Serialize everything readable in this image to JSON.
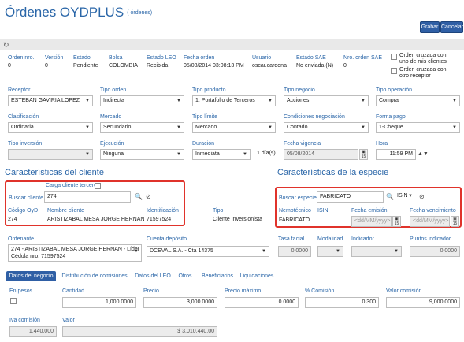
{
  "header": {
    "title": "Órdenes OYDPLUS",
    "subtitle": "( órdenes)"
  },
  "actions": {
    "save": "Grabar",
    "cancel": "Cancelar"
  },
  "summary": {
    "orden_nro": {
      "label": "Orden nro.",
      "value": "0"
    },
    "version": {
      "label": "Versión",
      "value": "0"
    },
    "estado": {
      "label": "Estado",
      "value": "Pendiente"
    },
    "bolsa": {
      "label": "Bolsa",
      "value": "COLOMBIA"
    },
    "estado_leo": {
      "label": "Estado LEO",
      "value": "Recibida"
    },
    "fecha_orden": {
      "label": "Fecha orden",
      "value": "05/08/2014 03:08:13 PM"
    },
    "usuario": {
      "label": "Usuario",
      "value": "oscar.cardona"
    },
    "estado_sae": {
      "label": "Estado SAE",
      "value": "No enviada (N)"
    },
    "orden_nro_sae": {
      "label": "Nro. orden SAE",
      "value": "0"
    },
    "cruzada_mis_clientes": "Orden cruzada con uno de mis clientes",
    "cruzada_otro_receptor": "Orden cruzada con otro receptor"
  },
  "row1": {
    "receptor": {
      "label": "Receptor",
      "value": "ESTEBAN GAVIRIA LOPEZ"
    },
    "tipo_orden": {
      "label": "Tipo orden",
      "value": "Indirecta"
    },
    "tipo_producto": {
      "label": "Tipo producto",
      "value": "1. Portafolio de Terceros"
    },
    "tipo_negocio": {
      "label": "Tipo negocio",
      "value": "Acciones"
    },
    "tipo_operacion": {
      "label": "Tipo operación",
      "value": "Compra"
    }
  },
  "row2": {
    "clasificacion": {
      "label": "Clasificación",
      "value": "Ordinaria"
    },
    "mercado": {
      "label": "Mercado",
      "value": "Secundario"
    },
    "tipo_limite": {
      "label": "Tipo límite",
      "value": "Mercado"
    },
    "condiciones": {
      "label": "Condiciones negociación",
      "value": "Contado"
    },
    "forma_pago": {
      "label": "Forma pago",
      "value": "1-Cheque"
    }
  },
  "row3": {
    "tipo_inversion": {
      "label": "Tipo inversión",
      "value": ""
    },
    "ejecucion": {
      "label": "Ejecución",
      "value": "Ninguna"
    },
    "duracion": {
      "label": "Duración",
      "value": "Inmediata",
      "suffix": "1 día(s)"
    },
    "fecha_vigencia": {
      "label": "Fecha vigencia",
      "value": "05/08/2014"
    },
    "hora": {
      "label": "Hora",
      "value": "11:59 PM"
    }
  },
  "cliente": {
    "section_title": "Características del cliente",
    "carga_tercero": "Carga cliente tercero",
    "buscar_label": "Buscar cliente",
    "buscar_value": "274",
    "codigo_label": "Código OyD",
    "codigo_value": "274",
    "nombre_label": "Nombre cliente",
    "nombre_value": "ARISTIZABAL MESA JORGE HERNAN",
    "ident_label": "Identificación",
    "ident_value": "71597524",
    "tipo_label": "Tipo",
    "tipo_value": "Cliente Inversionista"
  },
  "especie": {
    "section_title": "Características de la especie",
    "buscar_label": "Buscar especie",
    "buscar_value": "FABRICATO",
    "isin_select": "ISIN",
    "nemo_label": "Nemotécnico",
    "nemo_value": "FABRICATO",
    "isin_label": "ISIN",
    "fecha_emision_label": "Fecha emisión",
    "fecha_venc_label": "Fecha vencimiento",
    "date_placeholder": "<dd/MM/yyyy>",
    "cal_day": "15"
  },
  "row4": {
    "ordenante": {
      "label": "Ordenante",
      "line1": "274 - ARISTIZABAL MESA JORGE HERNAN - Líder",
      "line2": "Cédula nro. 71597524"
    },
    "cuenta": {
      "label": "Cuenta depósito",
      "value": "DCEVAL S.A. - Cta 14375"
    },
    "tasa_facial": {
      "label": "Tasa facial",
      "value": "0.0000"
    },
    "modalidad": {
      "label": "Modalidad",
      "value": ""
    },
    "indicador": {
      "label": "Indicador",
      "value": ""
    },
    "puntos": {
      "label": "Puntos indicador",
      "value": "0.0000"
    }
  },
  "tabs": [
    "Datos del negocio",
    "Distribución de comisiones",
    "Datos del LEO",
    "Otros",
    "Beneficiarios",
    "Liquidaciones"
  ],
  "negocio": {
    "en_pesos": {
      "label": "En pesos"
    },
    "cantidad": {
      "label": "Cantidad",
      "value": "1,000.0000"
    },
    "precio": {
      "label": "Precio",
      "value": "3,000.0000"
    },
    "precio_max": {
      "label": "Precio máximo",
      "value": "0.0000"
    },
    "comision_pct": {
      "label": "% Comisión",
      "value": "0.300"
    },
    "valor_comision": {
      "label": "Valor comisión",
      "value": "9,000.0000"
    },
    "iva_comision": {
      "label": "Iva comisión",
      "value": "1,440.000"
    },
    "valor": {
      "label": "Valor",
      "value": "$ 3,010,440.00"
    }
  },
  "icons": {
    "search": "search-icon",
    "clear": "clear-filter-icon",
    "refresh": "refresh-icon",
    "calendar": "calendar-icon"
  },
  "colors": {
    "accent": "#2a66a8",
    "button": "#2f5fa5",
    "highlight_box": "#e0332b"
  }
}
